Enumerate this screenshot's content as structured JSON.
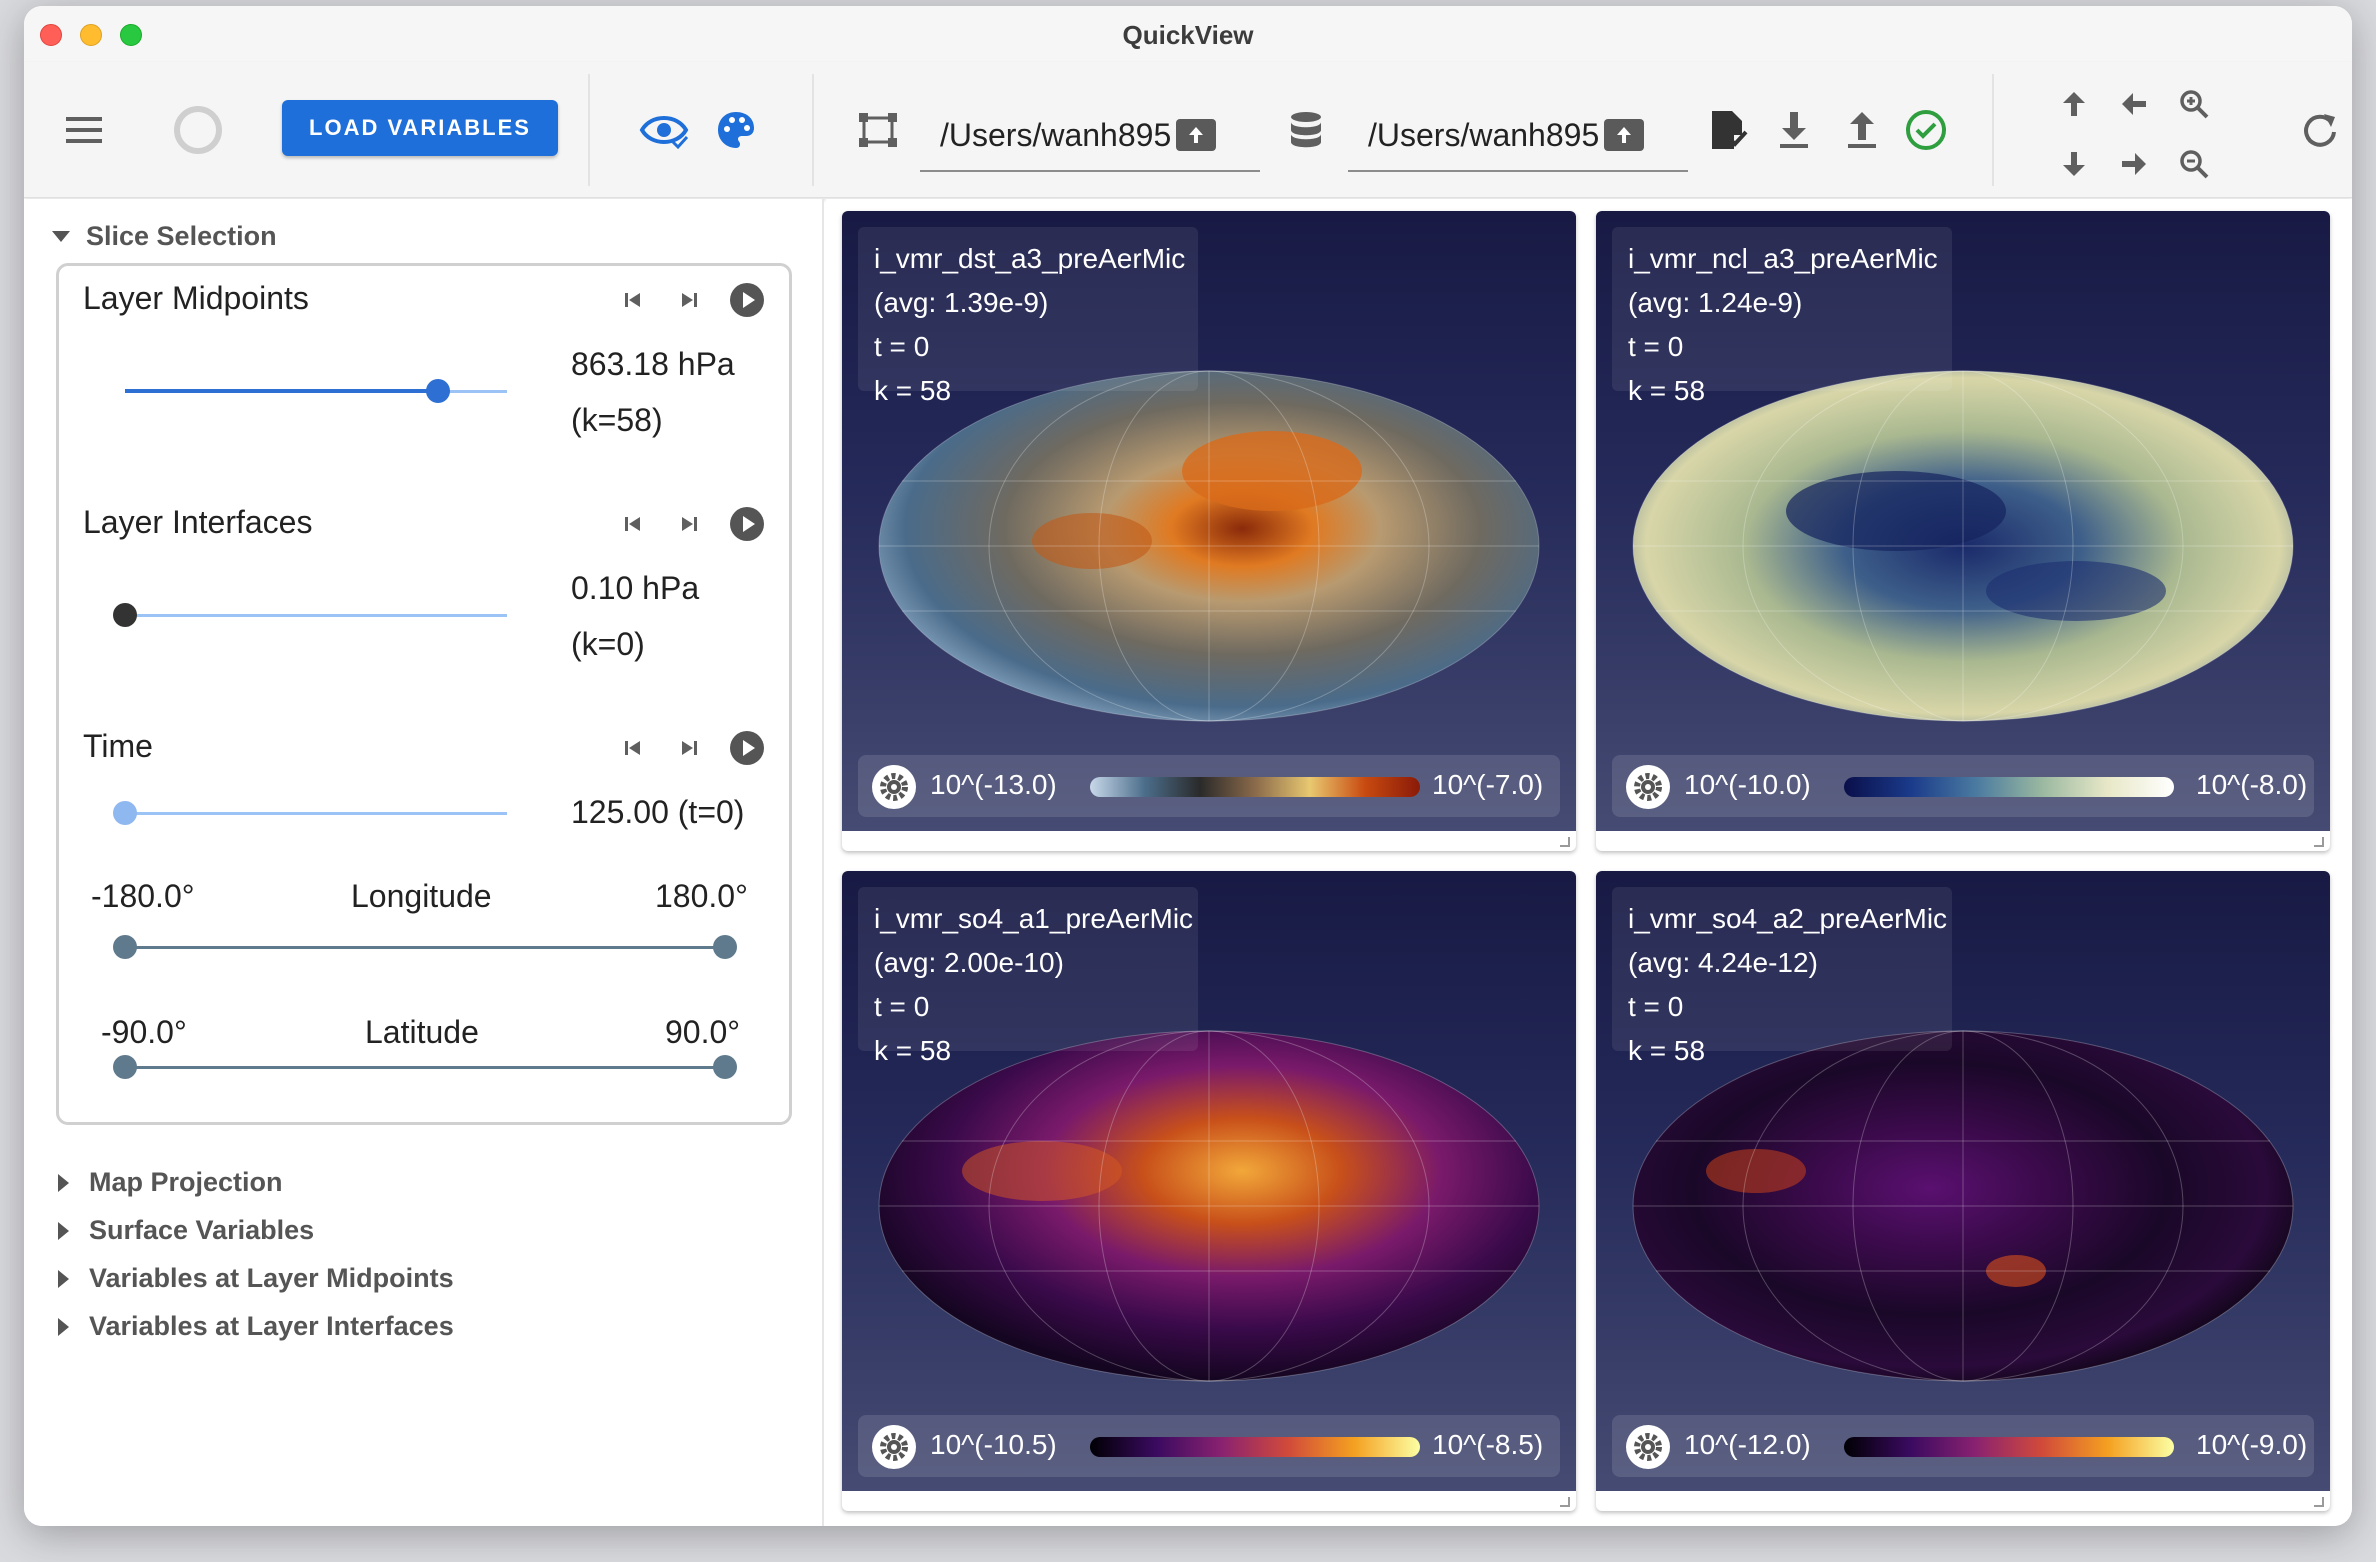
{
  "window": {
    "title": "QuickView"
  },
  "toolbar": {
    "load_label": "LOAD VARIABLES",
    "data_path": "/Users/wanh895,",
    "state_path": "/Users/wanh895,"
  },
  "left": {
    "slice_selection": "Slice Selection",
    "midpoints": {
      "label": "Layer Midpoints",
      "value": "863.18 hPa",
      "index": "(k=58)",
      "level": 0.82
    },
    "interfaces": {
      "label": "Layer Interfaces",
      "value": "0.10 hPa",
      "index": "(k=0)",
      "level": 0.0
    },
    "time": {
      "label": "Time",
      "value": "125.00 (t=0)",
      "level": 0.0
    },
    "longitude": {
      "label": "Longitude",
      "min": "-180.0°",
      "max": "180.0°"
    },
    "latitude": {
      "label": "Latitude",
      "min": "-90.0°",
      "max": "90.0°"
    },
    "collapsed": [
      "Map Projection",
      "Surface Variables",
      "Variables at Layer Midpoints",
      "Variables at Layer Interfaces"
    ]
  },
  "views": [
    {
      "name": "i_vmr_dst_a3_preAerMic",
      "avg": "(avg: 1.39e-9)",
      "t": "t = 0",
      "k": "k = 58",
      "cmin": "10^(-13.0)",
      "cmax": "10^(-7.0)",
      "colormap": "diverging-dust"
    },
    {
      "name": "i_vmr_ncl_a3_preAerMic",
      "avg": "(avg: 1.24e-9)",
      "t": "t = 0",
      "k": "k = 58",
      "cmin": "10^(-10.0)",
      "cmax": "10^(-8.0)",
      "colormap": "navy-cream"
    },
    {
      "name": "i_vmr_so4_a1_preAerMic",
      "avg": "(avg: 2.00e-10)",
      "t": "t = 0",
      "k": "k = 58",
      "cmin": "10^(-10.5)",
      "cmax": "10^(-8.5)",
      "colormap": "inferno"
    },
    {
      "name": "i_vmr_so4_a2_preAerMic",
      "avg": "(avg: 4.24e-12)",
      "t": "t = 0",
      "k": "k = 58",
      "cmin": "10^(-12.0)",
      "cmax": "10^(-9.0)",
      "colormap": "inferno"
    }
  ]
}
